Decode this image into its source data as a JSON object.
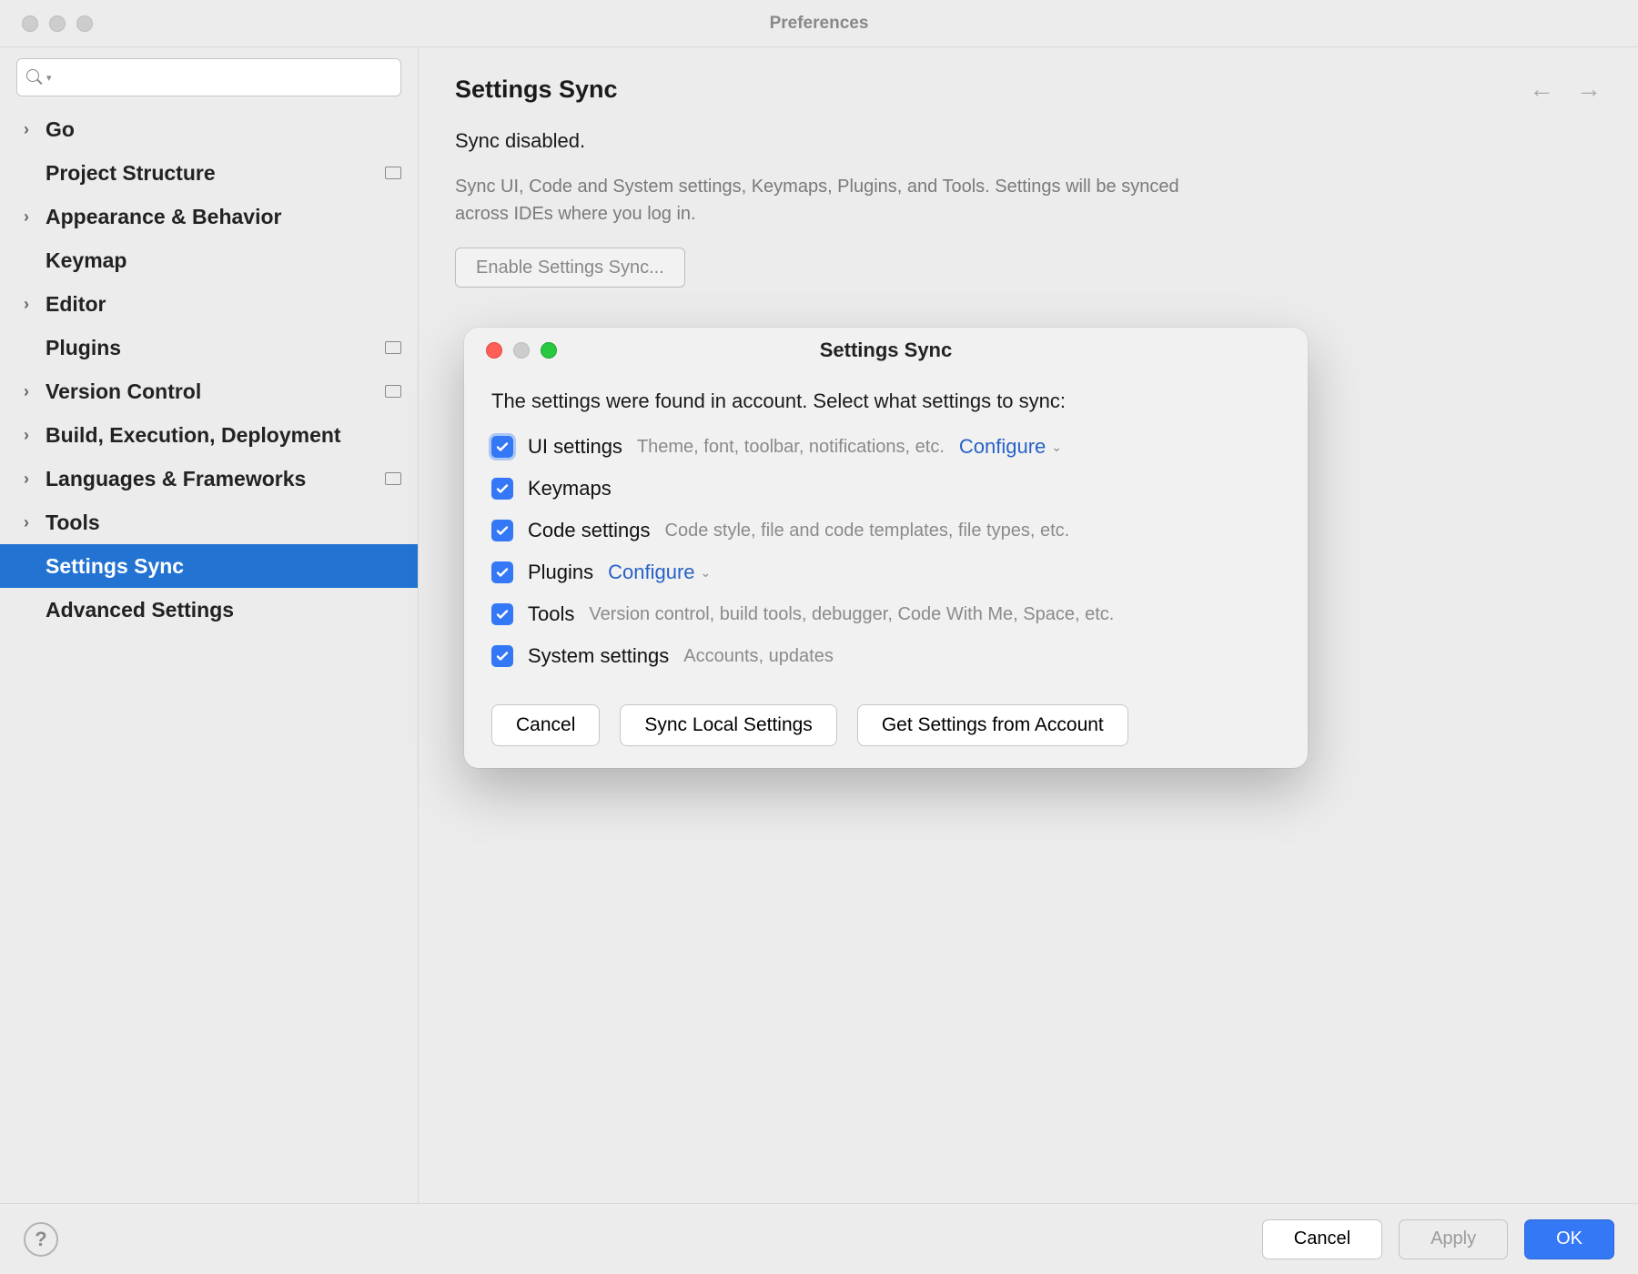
{
  "window": {
    "title": "Preferences"
  },
  "sidebar": {
    "search_placeholder": "",
    "items": [
      {
        "label": "Go",
        "expandable": true,
        "proj": false
      },
      {
        "label": "Project Structure",
        "expandable": false,
        "proj": true
      },
      {
        "label": "Appearance & Behavior",
        "expandable": true,
        "proj": false
      },
      {
        "label": "Keymap",
        "expandable": false,
        "proj": false
      },
      {
        "label": "Editor",
        "expandable": true,
        "proj": false
      },
      {
        "label": "Plugins",
        "expandable": false,
        "proj": true
      },
      {
        "label": "Version Control",
        "expandable": true,
        "proj": true
      },
      {
        "label": "Build, Execution, Deployment",
        "expandable": true,
        "proj": false
      },
      {
        "label": "Languages & Frameworks",
        "expandable": true,
        "proj": true
      },
      {
        "label": "Tools",
        "expandable": true,
        "proj": false
      },
      {
        "label": "Settings Sync",
        "expandable": false,
        "proj": false,
        "selected": true
      },
      {
        "label": "Advanced Settings",
        "expandable": false,
        "proj": false
      }
    ]
  },
  "content": {
    "title": "Settings Sync",
    "status": "Sync disabled.",
    "description": "Sync UI, Code and System settings, Keymaps, Plugins, and Tools. Settings will be synced across IDEs where you log in.",
    "enable_button": "Enable Settings Sync..."
  },
  "dialog": {
    "title": "Settings Sync",
    "message": "The settings were found in account. Select what settings to sync:",
    "options": [
      {
        "label": "UI settings",
        "hint": "Theme, font, toolbar, notifications, etc.",
        "configure": "Configure",
        "checked": true,
        "highlight": true
      },
      {
        "label": "Keymaps",
        "hint": "",
        "configure": "",
        "checked": true
      },
      {
        "label": "Code settings",
        "hint": "Code style, file and code templates, file types, etc.",
        "configure": "",
        "checked": true
      },
      {
        "label": "Plugins",
        "hint": "",
        "configure": "Configure",
        "checked": true
      },
      {
        "label": "Tools",
        "hint": "Version control, build tools, debugger, Code With Me, Space, etc.",
        "configure": "",
        "checked": true
      },
      {
        "label": "System settings",
        "hint": "Accounts, updates",
        "configure": "",
        "checked": true
      }
    ],
    "buttons": {
      "cancel": "Cancel",
      "sync_local": "Sync Local Settings",
      "get_from_account": "Get Settings from Account"
    }
  },
  "footer": {
    "cancel": "Cancel",
    "apply": "Apply",
    "ok": "OK"
  }
}
